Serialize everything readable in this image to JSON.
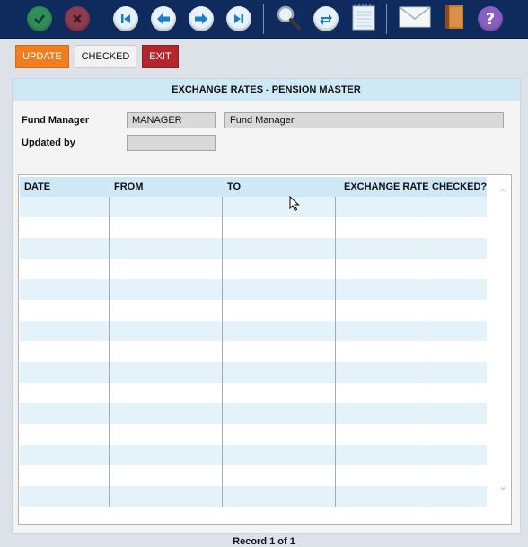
{
  "toolbar": {
    "icons": [
      "confirm-icon",
      "cancel-icon",
      "first-record-icon",
      "previous-record-icon",
      "next-record-icon",
      "last-record-icon",
      "search-icon",
      "refresh-icon",
      "notepad-icon",
      "mail-icon",
      "book-icon",
      "help-icon"
    ],
    "colors": {
      "background": "#0f2a5c",
      "confirm": "#2f8f5b",
      "cancel": "#9a3a4a",
      "nav": "#e8f3fb",
      "nav_arrow": "#1a7fc6"
    }
  },
  "actions": {
    "update_label": "UPDATE",
    "checked_label": "CHECKED",
    "exit_label": "EXIT"
  },
  "form": {
    "title": "EXCHANGE RATES - PENSION MASTER",
    "fund_manager_label": "Fund Manager",
    "fund_manager_code": "MANAGER",
    "fund_manager_name": "Fund Manager",
    "updated_by_label": "Updated by",
    "updated_by_value": ""
  },
  "grid": {
    "columns": [
      "DATE",
      "FROM",
      "TO",
      "EXCHANGE RATE",
      "CHECKED?"
    ],
    "rows": [
      [
        "",
        "",
        "",
        "",
        ""
      ],
      [
        "",
        "",
        "",
        "",
        ""
      ],
      [
        "",
        "",
        "",
        "",
        ""
      ],
      [
        "",
        "",
        "",
        "",
        ""
      ],
      [
        "",
        "",
        "",
        "",
        ""
      ],
      [
        "",
        "",
        "",
        "",
        ""
      ],
      [
        "",
        "",
        "",
        "",
        ""
      ],
      [
        "",
        "",
        "",
        "",
        ""
      ],
      [
        "",
        "",
        "",
        "",
        ""
      ],
      [
        "",
        "",
        "",
        "",
        ""
      ],
      [
        "",
        "",
        "",
        "",
        ""
      ],
      [
        "",
        "",
        "",
        "",
        ""
      ],
      [
        "",
        "",
        "",
        "",
        ""
      ],
      [
        "",
        "",
        "",
        "",
        ""
      ],
      [
        "",
        "",
        "",
        "",
        ""
      ]
    ],
    "colors": {
      "header": "#cfe8f6",
      "stripe": "#e3f3f9"
    }
  },
  "status": {
    "record_text": "Record 1 of 1"
  }
}
